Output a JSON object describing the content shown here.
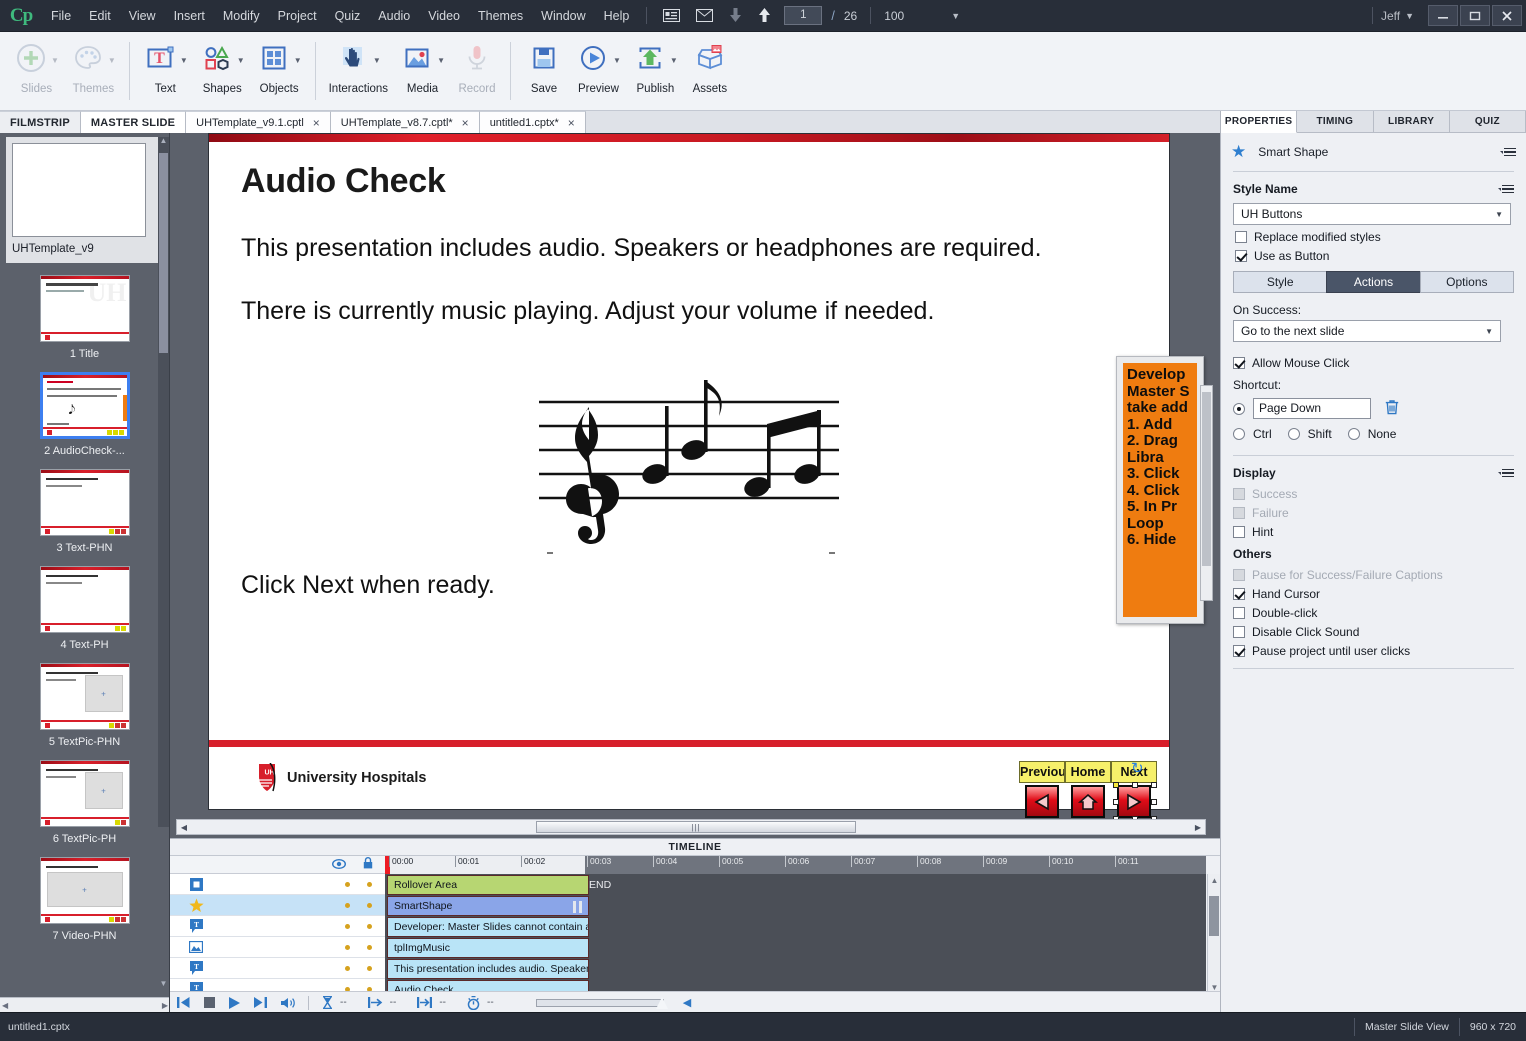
{
  "app": {
    "logo": "Cp",
    "user": "Jeff",
    "menus": [
      "File",
      "Edit",
      "View",
      "Insert",
      "Modify",
      "Project",
      "Quiz",
      "Audio",
      "Video",
      "Themes",
      "Window",
      "Help"
    ],
    "page_current": "1",
    "page_total": "26",
    "zoom": "100",
    "window_buttons": [
      "minimize",
      "maximize",
      "close"
    ]
  },
  "toolbar": {
    "groups": [
      {
        "items": [
          {
            "label": "Slides",
            "icon": "plus-circle-icon",
            "disabled": true,
            "caret": true
          },
          {
            "label": "Themes",
            "icon": "palette-icon",
            "disabled": true,
            "caret": true
          }
        ]
      },
      {
        "items": [
          {
            "label": "Text",
            "icon": "text-box-icon",
            "disabled": false,
            "caret": true
          },
          {
            "label": "Shapes",
            "icon": "shapes-icon",
            "disabled": false,
            "caret": true
          },
          {
            "label": "Objects",
            "icon": "objects-grid-icon",
            "disabled": false,
            "caret": true
          }
        ]
      },
      {
        "items": [
          {
            "label": "Interactions",
            "icon": "hand-click-icon",
            "disabled": false,
            "caret": true
          },
          {
            "label": "Media",
            "icon": "media-image-icon",
            "disabled": false,
            "caret": true
          },
          {
            "label": "Record",
            "icon": "microphone-icon",
            "disabled": true,
            "caret": false
          }
        ]
      },
      {
        "items": [
          {
            "label": "Save",
            "icon": "floppy-save-icon",
            "disabled": false,
            "caret": false
          },
          {
            "label": "Preview",
            "icon": "play-circle-icon",
            "disabled": false,
            "caret": true
          },
          {
            "label": "Publish",
            "icon": "publish-upload-icon",
            "disabled": false,
            "caret": true
          },
          {
            "label": "Assets",
            "icon": "assets-box-icon",
            "disabled": false,
            "caret": false
          }
        ]
      }
    ]
  },
  "tabs": [
    {
      "label": "FILMSTRIP",
      "bold": true,
      "closable": false,
      "active": false
    },
    {
      "label": "MASTER SLIDE",
      "bold": true,
      "closable": false,
      "active": true
    },
    {
      "label": "UHTemplate_v9.1.cptl",
      "bold": false,
      "closable": true,
      "active": false
    },
    {
      "label": "UHTemplate_v8.7.cptl*",
      "bold": false,
      "closable": true,
      "active": false
    },
    {
      "label": "untitled1.cptx*",
      "bold": false,
      "closable": true,
      "active": false
    }
  ],
  "filmstrip": {
    "master": {
      "label": "UHTemplate_v9"
    },
    "slides": [
      {
        "caption": "1 Title",
        "selected": false,
        "kind": "title"
      },
      {
        "caption": "2 AudioCheck-...",
        "selected": true,
        "kind": "audiocheck"
      },
      {
        "caption": "3 Text-PHN",
        "selected": false,
        "kind": "text"
      },
      {
        "caption": "4 Text-PH",
        "selected": false,
        "kind": "text"
      },
      {
        "caption": "5 TextPic-PHN",
        "selected": false,
        "kind": "textpic"
      },
      {
        "caption": "6 TextPic-PH",
        "selected": false,
        "kind": "textpic"
      },
      {
        "caption": "7 Video-PHN",
        "selected": false,
        "kind": "video"
      }
    ]
  },
  "slide": {
    "title": "Audio Check",
    "paragraph1": "This presentation includes audio. Speakers or headphones are required.",
    "paragraph2": "There is currently music playing. Adjust your volume if needed.",
    "paragraph3": "Click Next when ready.",
    "image_alt": "music-notes-image",
    "footer_brand": "University Hospitals",
    "dev_note_lines": [
      "Develop",
      "Master S",
      "take add",
      "1.  Add",
      "2.  Drag",
      "     Libra",
      "3.  Click",
      "4.  Click",
      "5.  In Pr",
      "     Loop",
      "6.  Hide"
    ],
    "nav_buttons": [
      {
        "caption": "Previou",
        "icon": "previous-triangle-icon",
        "selected": false
      },
      {
        "caption": "Home",
        "icon": "home-icon",
        "selected": false
      },
      {
        "caption": "Next",
        "icon": "next-triangle-icon",
        "selected": true
      }
    ]
  },
  "timeline": {
    "header": "TIMELINE",
    "eye_icon": "eye-icon",
    "lock_icon": "lock-icon",
    "end_marker": "END",
    "ticks": [
      "00:00",
      "00:01",
      "00:02",
      "00:03",
      "00:04",
      "00:05",
      "00:06",
      "00:07",
      "00:08",
      "00:09",
      "00:10",
      "00:11"
    ],
    "rows": [
      {
        "icon": "rollover-area-icon",
        "label": "Rollover Area",
        "color": "#b7d672",
        "selected": false,
        "paused": false
      },
      {
        "icon": "smartshape-star-icon",
        "label": "SmartShape",
        "color": "#8aa5e8",
        "selected": true,
        "paused": true
      },
      {
        "icon": "text-caption-icon",
        "label": "Developer:  Master Slides cannot contain a...",
        "color": "#b9e4f7",
        "selected": false,
        "paused": false
      },
      {
        "icon": "image-icon",
        "label": "tplImgMusic",
        "color": "#b9e4f7",
        "selected": false,
        "paused": false
      },
      {
        "icon": "text-caption-icon",
        "label": "This presentation includes audio. Speakers ...",
        "color": "#b9e4f7",
        "selected": false,
        "paused": false
      },
      {
        "icon": "text-caption-icon",
        "label": "Audio Check",
        "color": "#b9e4f7",
        "selected": false,
        "paused": false
      }
    ],
    "controls": {
      "icons": [
        "rewind-start-icon",
        "stop-icon",
        "play-icon",
        "step-end-icon",
        "volume-icon",
        "hourglass-icon",
        "start-arrow-icon",
        "end-arrow-icon",
        "stopwatch-icon"
      ],
      "values": [
        "--",
        "--",
        "--",
        "--"
      ]
    }
  },
  "properties": {
    "tabs": [
      {
        "label": "PROPERTIES",
        "active": true
      },
      {
        "label": "TIMING",
        "active": false
      },
      {
        "label": "LIBRARY",
        "active": false
      },
      {
        "label": "QUIZ",
        "active": false
      }
    ],
    "object_type": "Smart Shape",
    "style_section": "Style Name",
    "style_value": "UH Buttons",
    "replace_modified": {
      "label": "Replace modified styles",
      "checked": false,
      "disabled": false
    },
    "use_as_button": {
      "label": "Use as Button",
      "checked": true,
      "disabled": false
    },
    "segments": [
      {
        "label": "Style",
        "active": false
      },
      {
        "label": "Actions",
        "active": true
      },
      {
        "label": "Options",
        "active": false
      }
    ],
    "on_success_label": "On Success:",
    "on_success_value": "Go to the next slide",
    "allow_mouse_click": {
      "label": "Allow Mouse Click",
      "checked": true
    },
    "shortcut_label": "Shortcut:",
    "shortcut_value": "Page Down",
    "shortcut_radio_selected": true,
    "modifiers": [
      {
        "label": "Ctrl",
        "selected": false
      },
      {
        "label": "Shift",
        "selected": false
      },
      {
        "label": "None",
        "selected": false
      }
    ],
    "display_section": "Display",
    "display_items": [
      {
        "label": "Success",
        "checked": false,
        "disabled": true
      },
      {
        "label": "Failure",
        "checked": false,
        "disabled": true
      },
      {
        "label": "Hint",
        "checked": false,
        "disabled": false
      }
    ],
    "others_section": "Others",
    "others_items": [
      {
        "label": "Pause for Success/Failure Captions",
        "checked": false,
        "disabled": true
      },
      {
        "label": "Hand Cursor",
        "checked": true,
        "disabled": false
      },
      {
        "label": "Double-click",
        "checked": false,
        "disabled": false
      },
      {
        "label": "Disable Click Sound",
        "checked": false,
        "disabled": false
      },
      {
        "label": "Pause project until user clicks",
        "checked": true,
        "disabled": false
      }
    ]
  },
  "statusbar": {
    "filename": "untitled1.cptx",
    "view_mode": "Master Slide View",
    "dimensions": "960 x 720"
  },
  "colors": {
    "accent_red": "#d71f2b",
    "chrome_dark": "#282e39",
    "panel_bg": "#eef0f4",
    "orange_note": "#ef7c10",
    "selection_blue": "#3d7ff0"
  }
}
